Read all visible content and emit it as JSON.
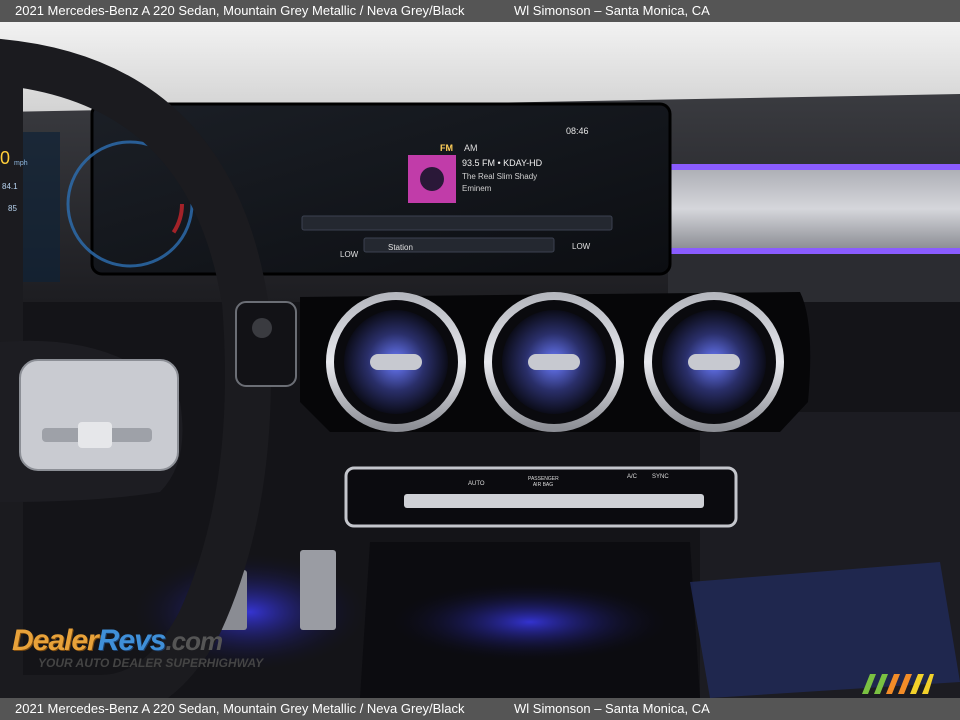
{
  "caption": {
    "vehicle": "2021 Mercedes-Benz A 220 Sedan,  Mountain Grey Metallic / Neva Grey/Black",
    "dealer": "Wl Simonson – Santa Monica, CA"
  },
  "screen": {
    "time": "08:46",
    "band_fm": "FM",
    "band_am": "AM",
    "station": "93.5 FM • KDAY-HD",
    "track": "The Real Slim Shady",
    "artist": "Eminem",
    "station_button": "Station",
    "low_left": "LOW",
    "low_right": "LOW"
  },
  "cluster": {
    "speed": "0",
    "speed_unit": "mph",
    "reading_a": "84.1",
    "reading_b": "85"
  },
  "climate_panel": {
    "auto": "AUTO",
    "passenger_airbag": "PASSENGER AIR BAG",
    "ac": "A/C",
    "sync": "SYNC"
  },
  "watermark": {
    "brand_a": "Dealer",
    "brand_b": "Revs",
    "brand_c": ".com",
    "tagline": "YOUR AUTO DEALER SUPERHIGHWAY"
  },
  "colors": {
    "ambient_light": "#8a5cff",
    "caption_bar": "#555555"
  }
}
